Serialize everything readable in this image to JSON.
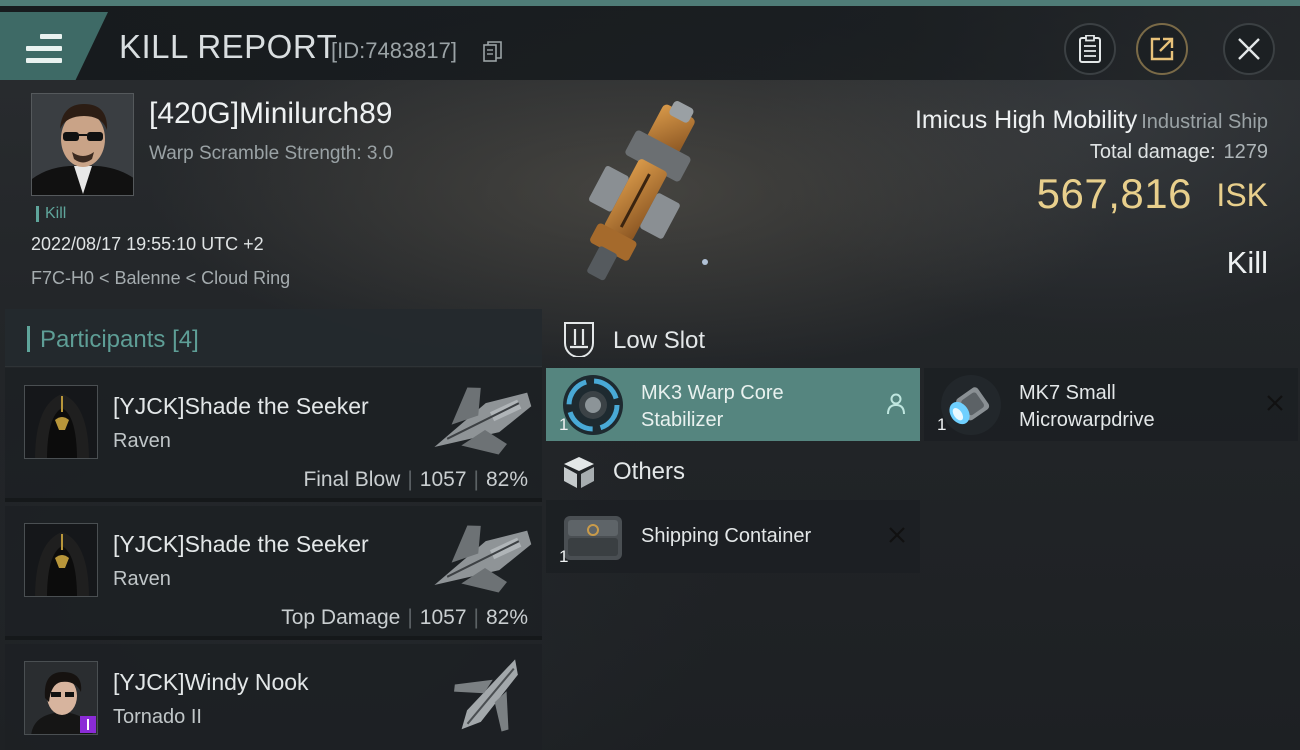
{
  "header": {
    "title": "KILL REPORT",
    "report_id": "[ID:7483817]",
    "icons": [
      "menu-icon",
      "copy-icon",
      "clipboard-icon",
      "share-icon",
      "close-icon"
    ]
  },
  "victim": {
    "name": "[420G]Minilurch89",
    "warp_scramble": "Warp Scramble Strength: 3.0",
    "tag": "Kill",
    "datetime": "2022/08/17 19:55:10 UTC +2",
    "location": "F7C-H0 < Balenne < Cloud Ring",
    "ship_name": "Imicus High Mobility",
    "ship_class": "Industrial Ship",
    "total_damage_label": "Total damage:",
    "total_damage": "1279",
    "isk_value": "567,816",
    "isk_unit": "ISK",
    "status": "Kill"
  },
  "participants": {
    "label": "Participants",
    "count": "[4]",
    "items": [
      {
        "name": "[YJCK]Shade the Seeker",
        "ship": "Raven",
        "role": "Final Blow",
        "damage": "1057",
        "percent": "82%"
      },
      {
        "name": "[YJCK]Shade the Seeker",
        "ship": "Raven",
        "role": "Top Damage",
        "damage": "1057",
        "percent": "82%"
      },
      {
        "name": "[YJCK]Windy Nook",
        "ship": "Tornado II",
        "role": "",
        "damage": "",
        "percent": ""
      }
    ],
    "separator": "|"
  },
  "fittings": {
    "low_slot": {
      "label": "Low Slot",
      "items": [
        {
          "qty": "1",
          "name_line1": "MK3 Warp Core",
          "name_line2": "Stabilizer",
          "state": "dropped"
        },
        {
          "qty": "1",
          "name_line1": "MK7 Small",
          "name_line2": "Microwarpdrive",
          "state": "destroyed"
        }
      ]
    },
    "others": {
      "label": "Others",
      "items": [
        {
          "qty": "1",
          "name_line1": "Shipping Container",
          "state": "destroyed"
        }
      ]
    }
  },
  "colors": {
    "accent": "#5fa59b",
    "isk": "#e8cf8c",
    "active_module": "#55857f"
  }
}
